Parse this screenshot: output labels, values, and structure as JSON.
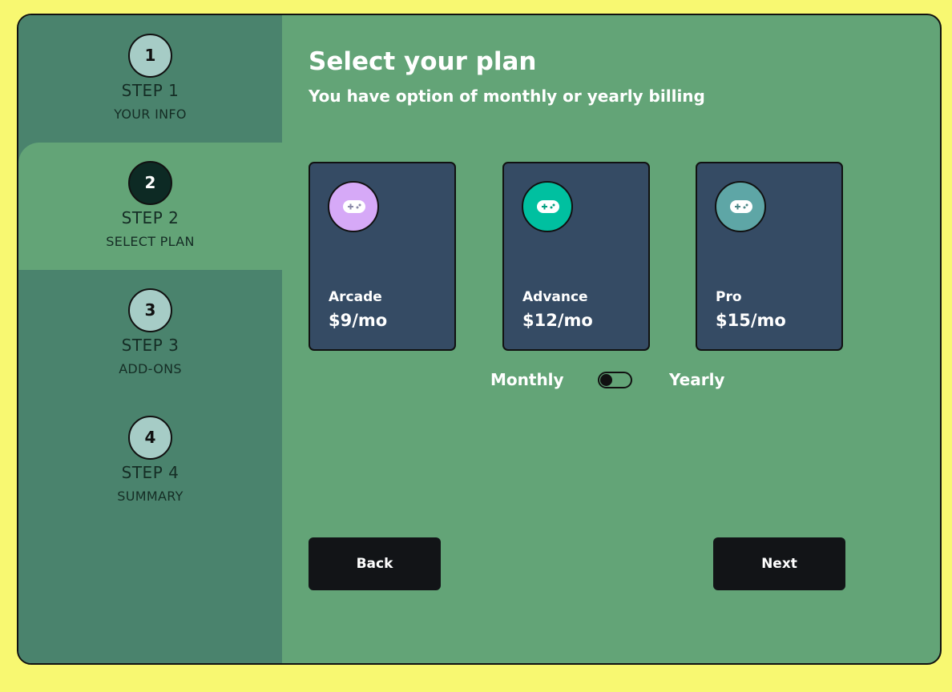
{
  "sidebar": {
    "steps": [
      {
        "number": "1",
        "title": "STEP 1",
        "subtitle": "YOUR INFO",
        "active": false
      },
      {
        "number": "2",
        "title": "STEP 2",
        "subtitle": "SELECT PLAN",
        "active": true
      },
      {
        "number": "3",
        "title": "STEP 3",
        "subtitle": "ADD-ONS",
        "active": false
      },
      {
        "number": "4",
        "title": "STEP 4",
        "subtitle": "SUMMARY",
        "active": false
      }
    ]
  },
  "main": {
    "title": "Select your plan",
    "subtitle": "You have option of monthly or yearly billing",
    "plans": [
      {
        "name": "Arcade",
        "price": "$9/mo",
        "icon": "gamepad-icon",
        "color": "#d6a9f7"
      },
      {
        "name": "Advance",
        "price": "$12/mo",
        "icon": "gamepad-icon",
        "color": "#00c0a0"
      },
      {
        "name": "Pro",
        "price": "$15/mo",
        "icon": "gamepad-icon",
        "color": "#5ea6a6"
      }
    ],
    "billing": {
      "monthly_label": "Monthly",
      "yearly_label": "Yearly",
      "selected": "Monthly"
    },
    "back_label": "Back",
    "next_label": "Next"
  },
  "colors": {
    "page_background": "#f8f871",
    "sidebar": "#4a836d",
    "main": "#63a477",
    "card": "#354b64",
    "button": "#121417"
  }
}
